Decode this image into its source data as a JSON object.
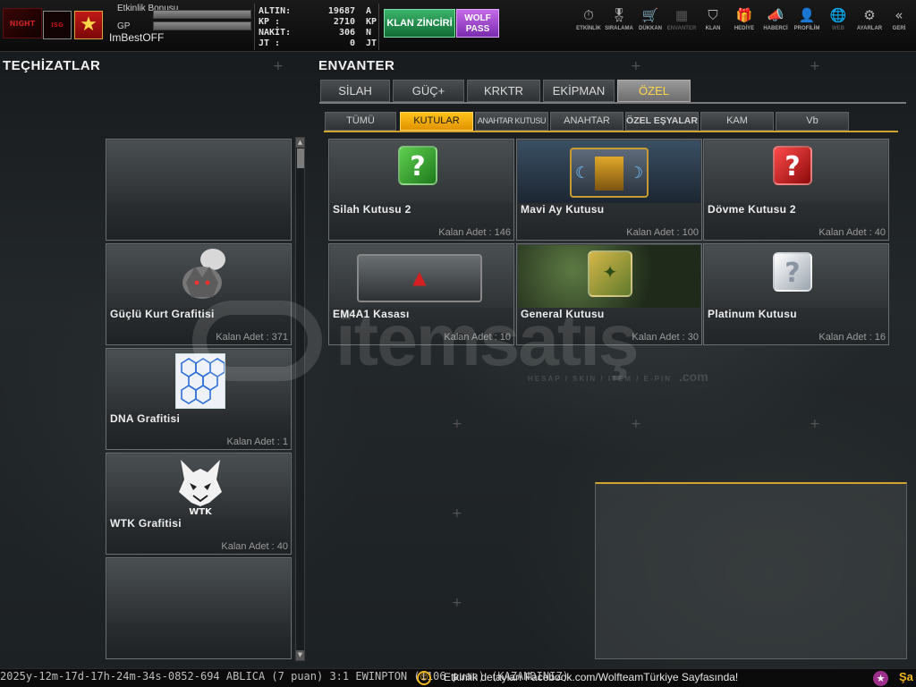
{
  "topbar": {
    "logo_text": "NIGHT",
    "clan_badge_text": "ISG",
    "player": {
      "event_bonus_label": "Etkinlik Bonusu",
      "gp_label": "GP",
      "name": "ImBestOFF"
    },
    "stats": [
      {
        "label": "ALTIN:",
        "value": "19687",
        "unit": "A"
      },
      {
        "label": "KP  :",
        "value": "2710",
        "unit": "KP"
      },
      {
        "label": "NAKİT:",
        "value": "306",
        "unit": "N"
      },
      {
        "label": "JT  :",
        "value": "0",
        "unit": "JT"
      }
    ],
    "klan_button": "KLAN ZİNCİRİ",
    "wolf_button_line1": "WOLF",
    "wolf_button_line2": "PASS",
    "nav": [
      {
        "label": "ETKİNLİK",
        "icon": "stopwatch-icon",
        "glyph": "⏱"
      },
      {
        "label": "SIRALAMA",
        "icon": "medal-icon",
        "glyph": "🎖"
      },
      {
        "label": "DÜKKAN",
        "icon": "cart-icon",
        "glyph": "🛒"
      },
      {
        "label": "ENVANTER",
        "icon": "inventory-icon",
        "glyph": "▦"
      },
      {
        "label": "KLAN",
        "icon": "shield-icon",
        "glyph": "⛉"
      },
      {
        "label": "HEDİYE",
        "icon": "gift-icon",
        "glyph": "🎁"
      },
      {
        "label": "HABERCİ",
        "icon": "megaphone-icon",
        "glyph": "📣"
      },
      {
        "label": "PROFİLİM",
        "icon": "profile-icon",
        "glyph": "👤"
      },
      {
        "label": "WEB",
        "icon": "globe-icon",
        "glyph": "🌐"
      },
      {
        "label": "AYARLAR",
        "icon": "gear-icon",
        "glyph": "⚙"
      },
      {
        "label": "GERİ",
        "icon": "back-icon",
        "glyph": "«"
      }
    ]
  },
  "equipment": {
    "title": "TEÇHİZATLAR",
    "items": [
      {
        "name": "",
        "count": ""
      },
      {
        "name": "Güçlü Kurt Grafitisi",
        "count": "Kalan Adet : 371"
      },
      {
        "name": "DNA Grafitisi",
        "count": "Kalan Adet : 1"
      },
      {
        "name": "WTK Grafitisi",
        "count": "Kalan Adet : 40"
      },
      {
        "name": "",
        "count": ""
      }
    ]
  },
  "inventory": {
    "title": "ENVANTER",
    "tabs": [
      "SİLAH",
      "GÜÇ+",
      "KRKTR",
      "EKİPMAN",
      "ÖZEL"
    ],
    "active_tab": "ÖZEL",
    "subtabs": [
      "TÜMÜ",
      "KUTULAR",
      "ANAHTAR KUTUSU",
      "ANAHTAR",
      "ÖZEL EŞYALAR",
      "KAM",
      "Vb"
    ],
    "active_subtab": "KUTULAR",
    "items": [
      {
        "name": "Silah Kutusu 2",
        "count": "Kalan Adet : 146"
      },
      {
        "name": "Mavi Ay Kutusu",
        "count": "Kalan Adet : 100"
      },
      {
        "name": "Dövme Kutusu 2",
        "count": "Kalan Adet : 40"
      },
      {
        "name": "EM4A1 Kasası",
        "count": "Kalan Adet : 10"
      },
      {
        "name": "General Kutusu",
        "count": "Kalan Adet : 30"
      },
      {
        "name": "Platinum Kutusu",
        "count": "Kalan Adet : 16"
      }
    ]
  },
  "watermark": {
    "text": "itemsatış",
    "subtext": "HESAP / SKIN / ITEM / E-PIN",
    "suffix": ".com"
  },
  "bottombar": {
    "ticker": "2025y-12m-17d-17h-24m-34s-0852-694  ABLICA (7 puan) 3:1 EWINPTON (1106 puan) (KAZANDINIZ)",
    "info": "Etkinlik detayları Facebook.com/WolfteamTürkiye Sayfasında!",
    "right_text": "Şa"
  }
}
